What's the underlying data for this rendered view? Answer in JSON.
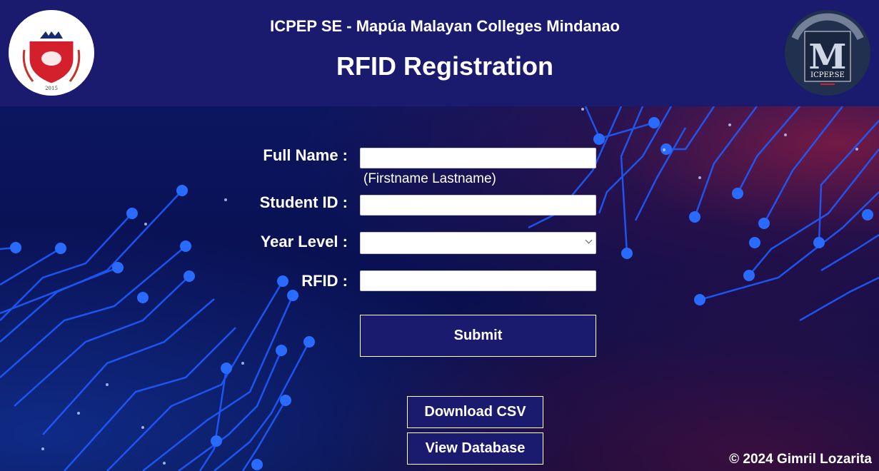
{
  "header": {
    "subtitle": "ICPEP SE - Mapúa Malayan Colleges Mindanao",
    "title": "RFID Registration",
    "left_logo": {
      "name": "mapua-mcm-seal-logo",
      "year": "2015"
    },
    "right_logo": {
      "name": "icpep-se-logo",
      "text": "ICPEP.SE",
      "letter": "M"
    }
  },
  "form": {
    "full_name": {
      "label": "Full Name :",
      "value": "",
      "hint": "(Firstname Lastname)"
    },
    "student_id": {
      "label": "Student ID :",
      "value": ""
    },
    "year_level": {
      "label": "Year Level :",
      "selected": ""
    },
    "rfid": {
      "label": "RFID :",
      "value": ""
    },
    "submit_label": "Submit"
  },
  "actions": {
    "download_csv_label": "Download CSV",
    "view_database_label": "View Database"
  },
  "footer": {
    "text": "© 2024 Gimril Lozarita"
  },
  "colors": {
    "header_bg": "#1a1a6e",
    "button_bg": "#1a1a6e",
    "page_bg": "#0a0f4a",
    "circuit_blue": "#1e5bff",
    "accent_red": "#c81e32"
  }
}
